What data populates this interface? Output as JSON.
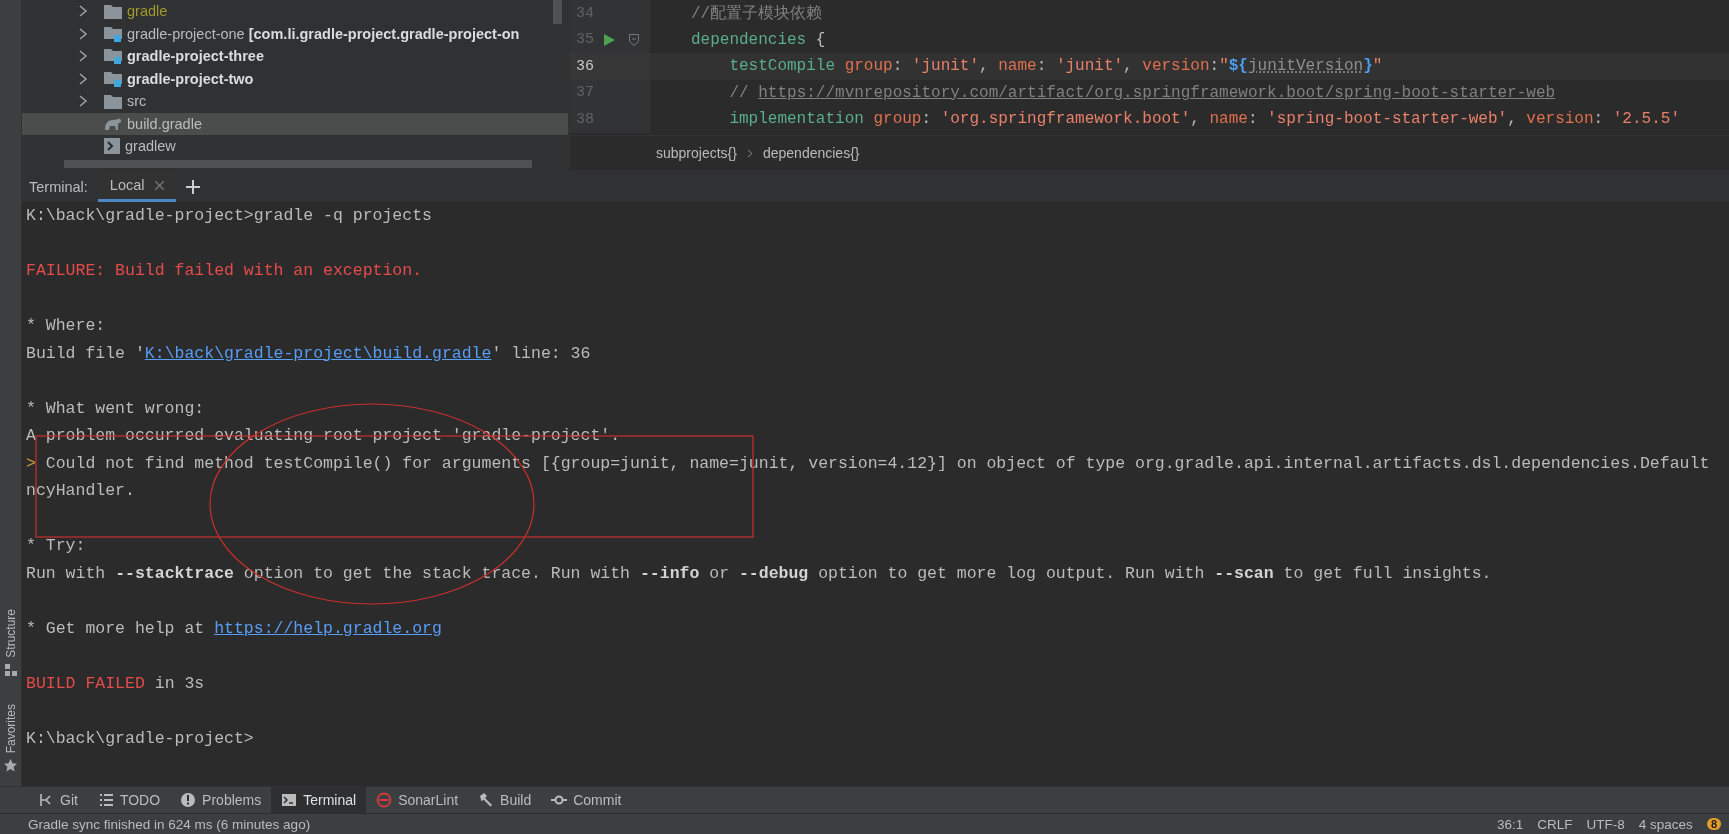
{
  "project_tree": {
    "items": [
      {
        "label": "gradle",
        "kind": "folder",
        "expandable": true,
        "ignored": true,
        "bold": false,
        "selected": false
      },
      {
        "label": "gradle-project-one",
        "module": "[com.li.gradle-project.gradle-project-on",
        "kind": "module",
        "expandable": true,
        "ignored": false,
        "bold": false,
        "selected": false
      },
      {
        "label": "gradle-project-three",
        "kind": "module",
        "expandable": true,
        "ignored": false,
        "bold": true,
        "selected": false
      },
      {
        "label": "gradle-project-two",
        "kind": "module",
        "expandable": true,
        "ignored": false,
        "bold": true,
        "selected": false
      },
      {
        "label": "src",
        "kind": "folder",
        "expandable": true,
        "ignored": false,
        "bold": false,
        "selected": false
      },
      {
        "label": "build.gradle",
        "kind": "gradle",
        "expandable": false,
        "ignored": false,
        "bold": false,
        "selected": true
      },
      {
        "label": "gradlew",
        "kind": "script",
        "expandable": false,
        "ignored": false,
        "bold": false,
        "selected": false
      }
    ]
  },
  "editor": {
    "lines": [
      {
        "number": "34",
        "current": false,
        "run_marker": false,
        "fold_marker": false,
        "tokens": [
          {
            "text": "//配置子模块依赖",
            "kind": "comment"
          }
        ]
      },
      {
        "number": "35",
        "current": false,
        "run_marker": true,
        "fold_marker": true,
        "tokens": [
          {
            "text": "dependencies",
            "kind": "keyword"
          },
          {
            "text": " {",
            "kind": "plain"
          }
        ]
      },
      {
        "number": "36",
        "current": true,
        "run_marker": false,
        "fold_marker": false,
        "tokens": [
          {
            "text": "    testCompile",
            "kind": "keyword"
          },
          {
            "text": " group",
            "kind": "named"
          },
          {
            "text": ": ",
            "kind": "plain"
          },
          {
            "text": "'junit'",
            "kind": "string"
          },
          {
            "text": ", ",
            "kind": "plain"
          },
          {
            "text": "name",
            "kind": "named"
          },
          {
            "text": ": ",
            "kind": "plain"
          },
          {
            "text": "'junit'",
            "kind": "string"
          },
          {
            "text": ", ",
            "kind": "plain"
          },
          {
            "text": "version",
            "kind": "named"
          },
          {
            "text": ":",
            "kind": "plain"
          },
          {
            "text": "\"",
            "kind": "string"
          },
          {
            "text": "${",
            "kind": "interp"
          },
          {
            "text": "junitVersion",
            "kind": "ref"
          },
          {
            "text": "}",
            "kind": "interp"
          },
          {
            "text": "\"",
            "kind": "string"
          }
        ]
      },
      {
        "number": "37",
        "current": false,
        "run_marker": false,
        "fold_marker": false,
        "tokens": [
          {
            "text": "    // ",
            "kind": "comment"
          },
          {
            "text": "https://mvnrepository.com/artifact/org.springframework.boot/spring-boot-starter-web",
            "kind": "url"
          }
        ]
      },
      {
        "number": "38",
        "current": false,
        "run_marker": false,
        "fold_marker": false,
        "tokens": [
          {
            "text": "    implementation",
            "kind": "keyword"
          },
          {
            "text": " group",
            "kind": "named"
          },
          {
            "text": ": ",
            "kind": "plain"
          },
          {
            "text": "'org.springframework.boot'",
            "kind": "string"
          },
          {
            "text": ", ",
            "kind": "plain"
          },
          {
            "text": "name",
            "kind": "named"
          },
          {
            "text": ": ",
            "kind": "plain"
          },
          {
            "text": "'spring-boot-starter-web'",
            "kind": "string"
          },
          {
            "text": ", ",
            "kind": "plain"
          },
          {
            "text": "version",
            "kind": "named"
          },
          {
            "text": ": ",
            "kind": "plain"
          },
          {
            "text": "'2.5.5'",
            "kind": "string"
          }
        ]
      }
    ],
    "breadcrumbs": [
      "subprojects{}",
      "dependencies{}"
    ]
  },
  "terminal": {
    "title": "Terminal:",
    "tabs": [
      {
        "label": "Local",
        "selected": true
      }
    ],
    "blocks": [
      {
        "lines": [
          [
            {
              "text": "K:\\back\\gradle-project>gradle -q projects",
              "kind": "plain"
            }
          ]
        ]
      },
      {
        "lines": [
          [
            {
              "text": "FAILURE: Build failed with an exception.",
              "kind": "error"
            }
          ]
        ]
      },
      {
        "lines": [
          [
            {
              "text": "* Where:",
              "kind": "plain"
            }
          ],
          [
            {
              "text": "Build file '",
              "kind": "plain"
            },
            {
              "text": "K:\\back\\gradle-project\\build.gradle",
              "kind": "link"
            },
            {
              "text": "' line: 36",
              "kind": "plain"
            }
          ]
        ]
      },
      {
        "lines": [
          [
            {
              "text": "* What went wrong:",
              "kind": "plain"
            }
          ],
          [
            {
              "text": "A problem occurred evaluating root project 'gradle-project'.",
              "kind": "plain"
            }
          ],
          [
            {
              "text": ">",
              "kind": "marker"
            },
            {
              "text": " Could not find method testCompile() for arguments [{group=junit, name=junit, version=4.12}] on object of type org.gradle.api.internal.artifacts.dsl.dependencies.Default",
              "kind": "plain"
            }
          ],
          [
            {
              "text": "ncyHandler.",
              "kind": "plain"
            }
          ]
        ]
      },
      {
        "lines": [
          [
            {
              "text": "* Try:",
              "kind": "plain"
            }
          ],
          [
            {
              "text": "Run with ",
              "kind": "plain"
            },
            {
              "text": "--stacktrace",
              "kind": "bold"
            },
            {
              "text": " option to get the stack trace. Run with ",
              "kind": "plain"
            },
            {
              "text": "--info",
              "kind": "bold"
            },
            {
              "text": " or ",
              "kind": "plain"
            },
            {
              "text": "--debug",
              "kind": "bold"
            },
            {
              "text": " option to get more log output. Run with ",
              "kind": "plain"
            },
            {
              "text": "--scan",
              "kind": "bold"
            },
            {
              "text": " to get full insights.",
              "kind": "plain"
            }
          ]
        ]
      },
      {
        "lines": [
          [
            {
              "text": "* Get more help at ",
              "kind": "plain"
            },
            {
              "text": "https://help.gradle.org",
              "kind": "link"
            }
          ]
        ]
      },
      {
        "lines": [
          [
            {
              "text": "BUILD FAILED",
              "kind": "error"
            },
            {
              "text": " in 3s",
              "kind": "plain"
            }
          ]
        ]
      },
      {
        "lines": [
          [
            {
              "text": "K:\\back\\gradle-project>",
              "kind": "plain"
            }
          ]
        ]
      }
    ]
  },
  "tool_windows": [
    {
      "label": "Structure",
      "kind": "structure"
    },
    {
      "label": "Favorites",
      "kind": "star"
    }
  ],
  "bottom_toolbar": [
    {
      "label": "Git",
      "kind": "git",
      "selected": false
    },
    {
      "label": "TODO",
      "kind": "list",
      "selected": false
    },
    {
      "label": "Problems",
      "kind": "info",
      "selected": false
    },
    {
      "label": "Terminal",
      "kind": "terminal",
      "selected": true
    },
    {
      "label": "SonarLint",
      "kind": "sonar",
      "selected": false
    },
    {
      "label": "Build",
      "kind": "hammer",
      "selected": false
    },
    {
      "label": "Commit",
      "kind": "commit",
      "selected": false
    }
  ],
  "status_bar": {
    "message": "Gradle sync finished in 624 ms (6 minutes ago)",
    "items": [
      "36:1",
      "CRLF",
      "UTF-8",
      "4 spaces"
    ],
    "badge": "8"
  }
}
